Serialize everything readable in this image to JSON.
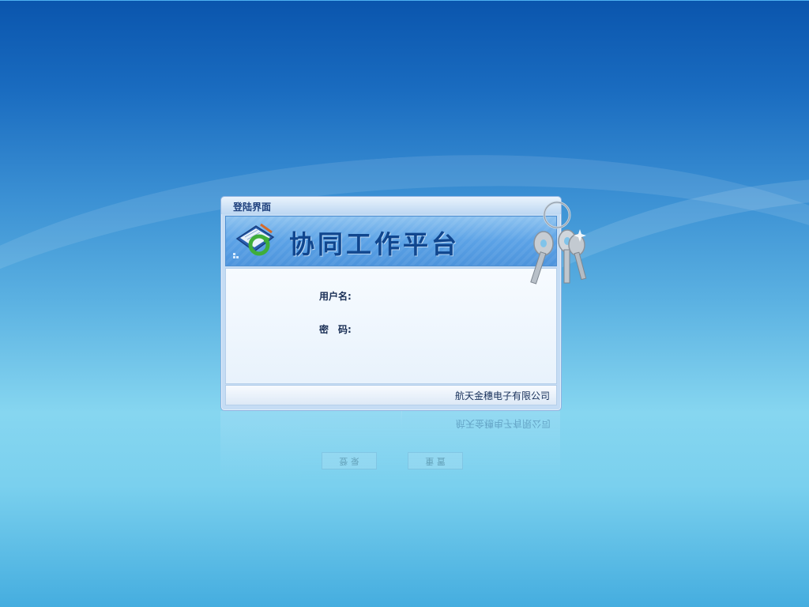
{
  "window": {
    "title": "登陆界面"
  },
  "banner": {
    "title": "协同工作平台",
    "logo_icon": "notebook-refresh-icon"
  },
  "form": {
    "username_label": "用户名:",
    "username_value": "",
    "password_label": "密　码:",
    "password_value": ""
  },
  "footer": {
    "company": "航天金穗电子有限公司"
  },
  "reflection": {
    "login_label": "登 录",
    "reset_label": "重 置"
  },
  "decor": {
    "keys_icon": "keys-icon"
  },
  "colors": {
    "background_top": "#0a55ad",
    "background_bottom": "#45addf",
    "banner_blue": "#5ba2e6",
    "title_text": "#10468e"
  }
}
